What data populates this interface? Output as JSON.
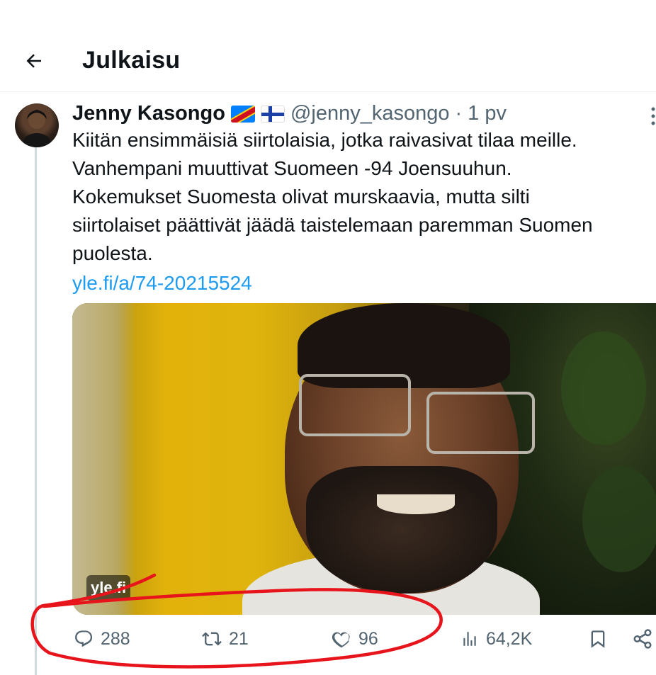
{
  "header": {
    "title": "Julkaisu",
    "back_icon": "arrow-left-icon"
  },
  "tweet": {
    "author_name": "Jenny Kasongo",
    "flags": [
      "flag-dr-congo-icon",
      "flag-finland-icon"
    ],
    "handle": "@jenny_kasongo",
    "separator": "·",
    "time": "1 pv",
    "text": "Kiitän ensimmäisiä siirtolaisia, jotka raivasivat tilaa meille.\nVanhempani muuttivat Suomeen -94 Joensuuhun.\nKokemukset Suomesta olivat murskaavia, mutta silti\nsiirtolaiset päättivät jäädä taistelemaan paremman Suomen\npuolesta.",
    "link": "yle.fi/a/74-20215524",
    "media_badge": "yle.fi"
  },
  "actions": {
    "replies": "288",
    "retweets": "21",
    "likes": "96",
    "views": "64,2K"
  },
  "colors": {
    "text": "#0f1419",
    "secondary": "#536471",
    "link": "#1d9bf0",
    "annotation": "#e8141c"
  }
}
